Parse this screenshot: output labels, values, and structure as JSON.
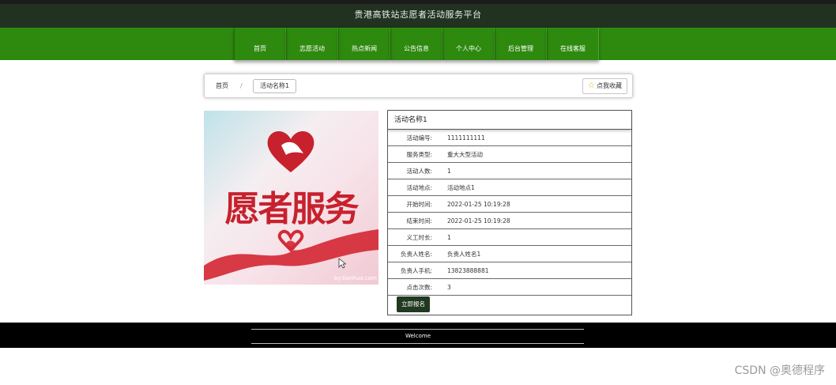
{
  "header": {
    "title": "贵港高铁站志愿者活动服务平台"
  },
  "nav": {
    "items": [
      {
        "label": "首页"
      },
      {
        "label": "志愿活动"
      },
      {
        "label": "热点新闻"
      },
      {
        "label": "公告信息"
      },
      {
        "label": "个人中心"
      },
      {
        "label": "后台管理"
      },
      {
        "label": "在线客服"
      }
    ]
  },
  "breadcrumb": {
    "home": "首页",
    "separator": "/",
    "current": "活动名称1",
    "favorite_label": "点我收藏"
  },
  "poster": {
    "text": "愿者服务",
    "signature": "by:tianhua.com"
  },
  "activity": {
    "title": "活动名称1",
    "fields": [
      {
        "label": "活动编号:",
        "value": "1111111111"
      },
      {
        "label": "服务类型:",
        "value": "重大大型活动"
      },
      {
        "label": "活动人数:",
        "value": "1"
      },
      {
        "label": "活动地点:",
        "value": "活动地点1"
      },
      {
        "label": "开始时间:",
        "value": "2022-01-25 10:19:28"
      },
      {
        "label": "结束时间:",
        "value": "2022-01-25 10:19:28"
      },
      {
        "label": "义工时长:",
        "value": "1"
      },
      {
        "label": "负责人姓名:",
        "value": "负责人姓名1"
      },
      {
        "label": "负责人手机:",
        "value": "13823888881"
      },
      {
        "label": "点击次数:",
        "value": "3"
      }
    ],
    "signup_label": "立即报名"
  },
  "footer": {
    "text": "Welcome"
  },
  "watermark": "CSDN @奥德程序",
  "colors": {
    "nav_green": "#2e8a0f",
    "header_dark": "#213221",
    "poster_red": "#c7212d"
  }
}
